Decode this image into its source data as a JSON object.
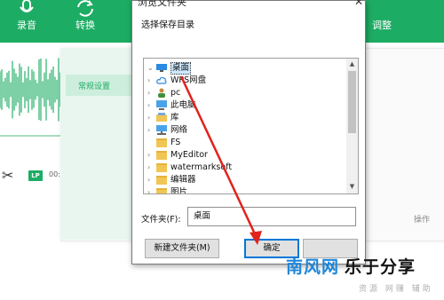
{
  "app": {
    "header": {
      "record_label": "录音",
      "convert_label": "转换",
      "adjust_label": "调整"
    },
    "toolbar": {
      "lp_badge": "LP",
      "time_text": "00:0"
    },
    "settings": {
      "tab_label": "常规设置",
      "ops_label": "操作"
    },
    "volume_level": 0.4,
    "accent_color": "#1dac64"
  },
  "dialog": {
    "title": "浏览文件夹",
    "close_glyph": "✕",
    "prompt": "选择保存目录",
    "tree": [
      {
        "label": "桌面",
        "icon": "desktop-icon",
        "selected": true,
        "expandable": false
      },
      {
        "label": "WPS网盘",
        "icon": "cloud-icon",
        "expandable": true
      },
      {
        "label": "pc",
        "icon": "user-icon",
        "expandable": true
      },
      {
        "label": "此电脑",
        "icon": "computer-icon",
        "expandable": true
      },
      {
        "label": "库",
        "icon": "library-icon",
        "expandable": true
      },
      {
        "label": "网络",
        "icon": "network-icon",
        "expandable": true
      },
      {
        "label": "FS",
        "icon": "folder-icon",
        "expandable": false
      },
      {
        "label": "MyEditor",
        "icon": "folder-icon",
        "expandable": true
      },
      {
        "label": "watermarksoft",
        "icon": "folder-icon",
        "expandable": true
      },
      {
        "label": "编辑器",
        "icon": "folder-icon",
        "expandable": true
      },
      {
        "label": "图片",
        "icon": "folder-icon",
        "expandable": true
      }
    ],
    "folder_label": "文件夹(F):",
    "folder_value": "桌面",
    "new_folder_button": "新建文件夹(M)",
    "ok_button": "确定",
    "cancel_button": ""
  },
  "watermark": {
    "brand_part1": "南风网",
    "brand_part2": "乐于分享",
    "sub": "资源 网赚 辅助"
  }
}
